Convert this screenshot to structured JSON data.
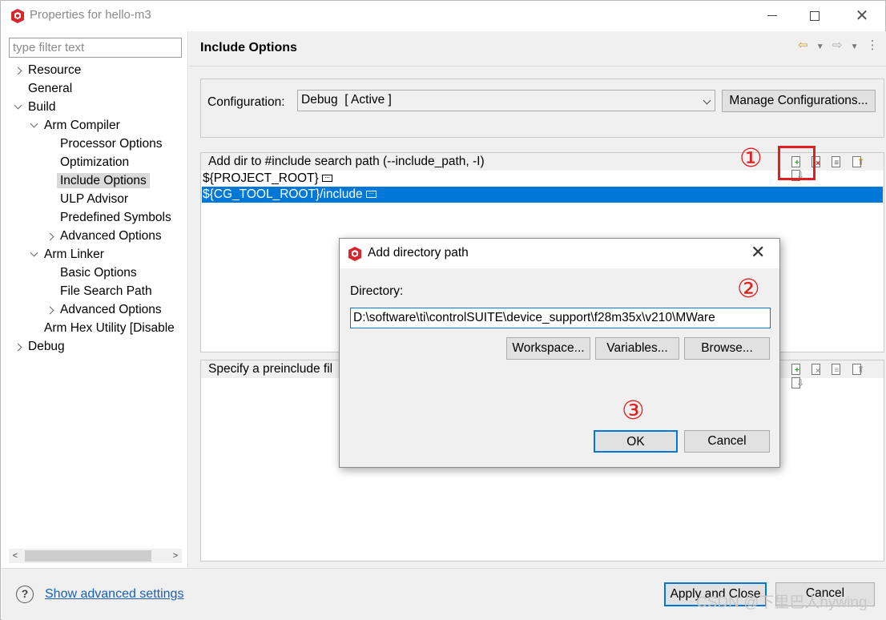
{
  "window": {
    "title": "Properties for hello-m3"
  },
  "filter": {
    "placeholder": "type filter text"
  },
  "tree": {
    "resource": "Resource",
    "general": "General",
    "build": "Build",
    "arm_compiler": "Arm Compiler",
    "processor_options": "Processor Options",
    "optimization": "Optimization",
    "include_options": "Include Options",
    "ulp_advisor": "ULP Advisor",
    "predefined_symbols": "Predefined Symbols",
    "compiler_advanced_options": "Advanced Options",
    "arm_linker": "Arm Linker",
    "basic_options": "Basic Options",
    "file_search_path": "File Search Path",
    "linker_advanced_options": "Advanced Options",
    "arm_hex_utility": "Arm Hex Utility  [Disable",
    "debug": "Debug"
  },
  "page": {
    "title": "Include Options"
  },
  "configuration": {
    "label": "Configuration:",
    "value": "Debug  [ Active ]",
    "manage_button": "Manage Configurations..."
  },
  "include_paths": {
    "title": "Add dir to #include search path (--include_path, -I)",
    "items": [
      "${PROJECT_ROOT}",
      "${CG_TOOL_ROOT}/include"
    ]
  },
  "preinclude": {
    "title": "Specify a preinclude fil"
  },
  "annotations": {
    "step1": "①",
    "step2": "②",
    "step3": "③"
  },
  "dialog": {
    "title": "Add directory path",
    "directory_label": "Directory:",
    "directory_value": "D:\\software\\ti\\controlSUITE\\device_support\\f28m35x\\v210\\MWare",
    "workspace_button": "Workspace...",
    "variables_button": "Variables...",
    "browse_button": "Browse...",
    "ok_button": "OK",
    "cancel_button": "Cancel"
  },
  "bottom": {
    "help_icon": "?",
    "advanced_link": "Show advanced settings",
    "apply_close": "Apply and Close",
    "cancel": "Cancel"
  },
  "watermark": "CSDN @下里巴人hywing",
  "colors": {
    "selection": "#0078d7",
    "annotation": "#e02020",
    "link": "#1a5fb4"
  }
}
